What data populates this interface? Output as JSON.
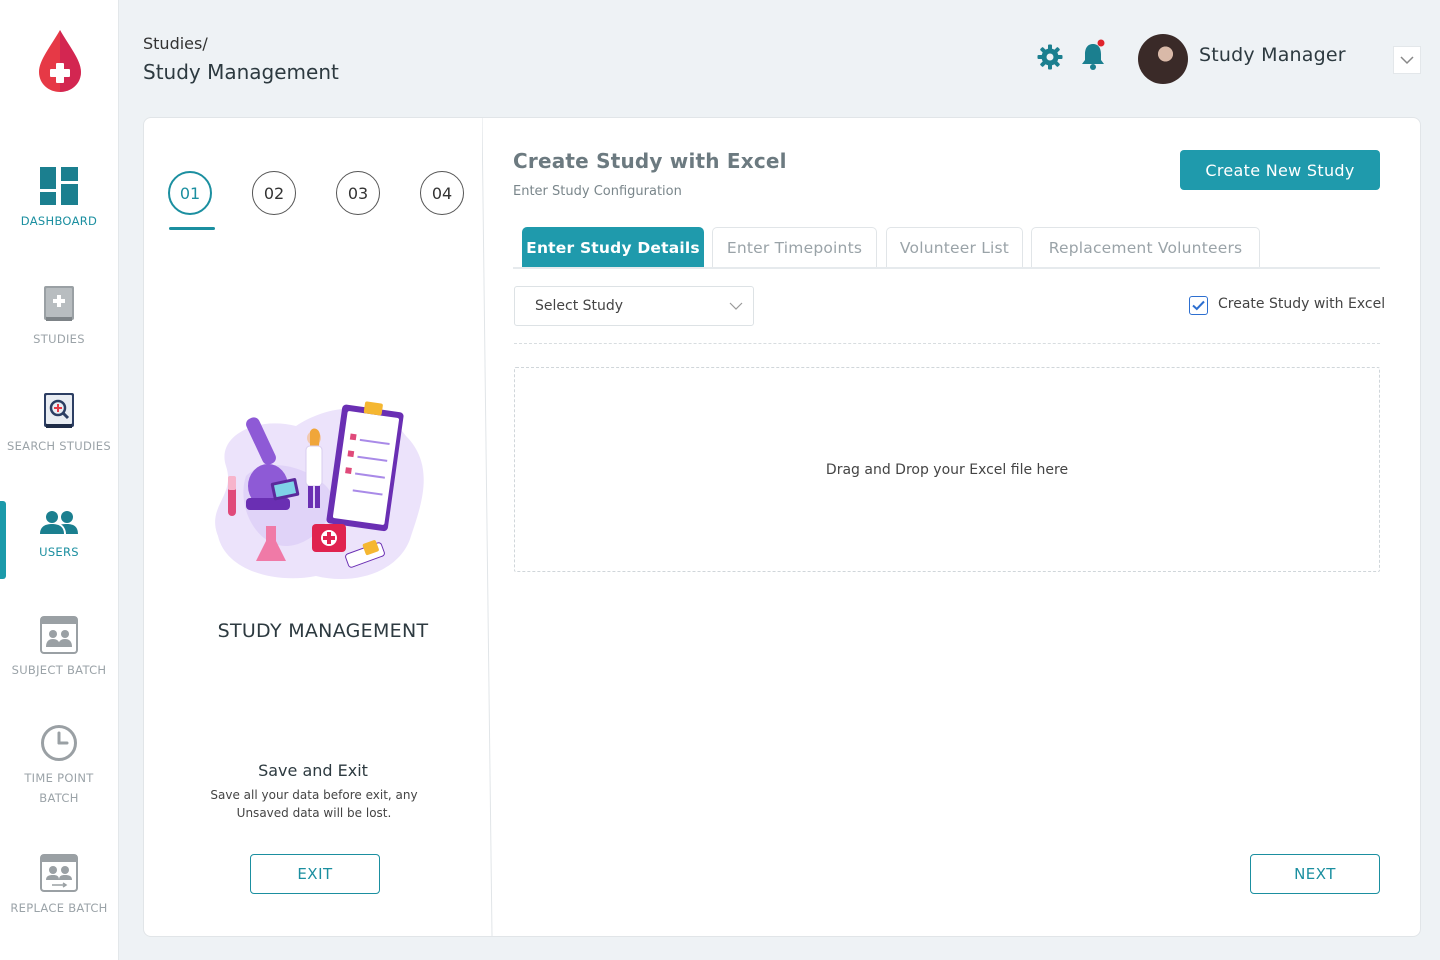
{
  "sidebar": {
    "items": [
      {
        "label": "DASHBOARD",
        "icon": "dashboard-icon"
      },
      {
        "label": "STUDIES",
        "icon": "studies-icon"
      },
      {
        "label": "SEARCH STUDIES",
        "icon": "search-studies-icon"
      },
      {
        "label": "USERS",
        "icon": "users-icon"
      },
      {
        "label": "SUBJECT BATCH",
        "icon": "subject-batch-icon"
      },
      {
        "label": "TIME POINT BATCH",
        "icon": "clock-icon"
      },
      {
        "label": "REPLACE BATCH",
        "icon": "replace-batch-icon"
      }
    ],
    "active": "USERS"
  },
  "header": {
    "breadcrumb": "Studies/",
    "title": "Study Management",
    "user_name": "Study Manager"
  },
  "steps": {
    "items": [
      "01",
      "02",
      "03",
      "04"
    ],
    "active": "01"
  },
  "left": {
    "section_title": "STUDY MANAGEMENT",
    "save_title": "Save and Exit",
    "save_desc": "Save all your data before exit, any Unsaved data will be lost.",
    "exit_label": "EXIT"
  },
  "right": {
    "title": "Create Study with Excel",
    "subtitle": "Enter Study Configuration",
    "create_button": "Create New Study",
    "tabs": [
      "Enter Study Details",
      "Enter Timepoints",
      "Volunteer List",
      "Replacement Volunteers"
    ],
    "active_tab": "Enter Study Details",
    "select_placeholder": "Select Study",
    "checkbox_label": "Create Study with Excel",
    "checkbox_checked": true,
    "dropzone_text": "Drag and Drop your Excel file here",
    "next_label": "NEXT"
  },
  "colors": {
    "accent": "#1f9aac",
    "logo_red": "#e63946",
    "nav_icon": "#1b7f8f",
    "notification_dot": "#e0232b"
  }
}
